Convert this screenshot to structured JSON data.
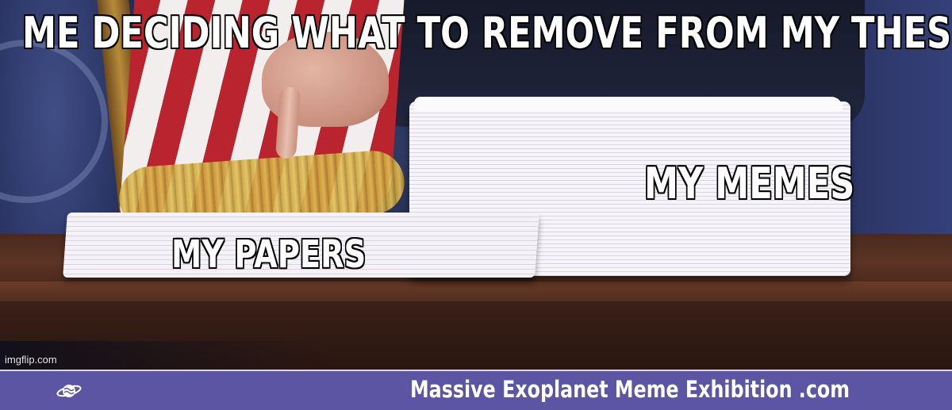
{
  "meme": {
    "top_caption": "ME DECIDING WHAT TO REMOVE FROM MY THESIS",
    "big_stack_label": "MY MEMES",
    "small_stack_label": "MY PAPERS",
    "watermark": "imgflip.com"
  },
  "banner": {
    "site_name": "Massive Exoplanet Meme Exhibition .com",
    "logo_icon": "planet-logo-icon",
    "background_color": "#5b55a3"
  }
}
